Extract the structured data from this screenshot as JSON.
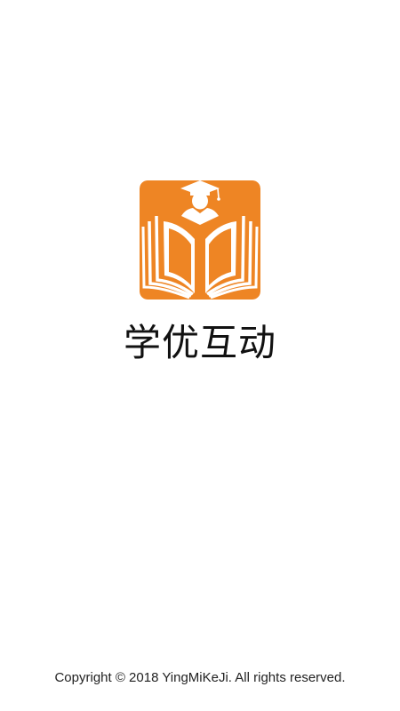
{
  "splash": {
    "app_name": "学优互动",
    "copyright": "Copyright © 2018 YingMiKeJi. All rights reserved.",
    "logo": {
      "icon": "open-book-graduate-logo",
      "background_color": "#EE8524",
      "foreground_color": "#FFFFFF"
    }
  }
}
